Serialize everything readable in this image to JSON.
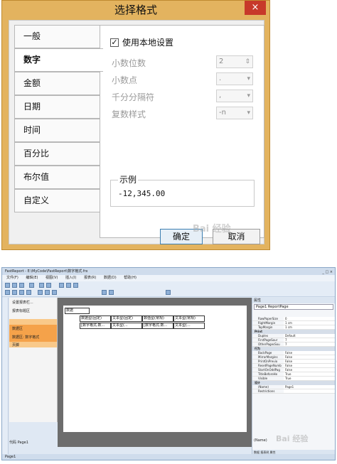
{
  "dialog": {
    "title": "选择格式",
    "close_glyph": "×",
    "tabs": [
      {
        "label": "一般",
        "active": false
      },
      {
        "label": "数字",
        "active": true
      },
      {
        "label": "金额",
        "active": false
      },
      {
        "label": "日期",
        "active": false
      },
      {
        "label": "时间",
        "active": false
      },
      {
        "label": "百分比",
        "active": false
      },
      {
        "label": "布尔值",
        "active": false
      },
      {
        "label": "自定义",
        "active": false
      }
    ],
    "use_local": {
      "label": "使用本地设置",
      "checked": true,
      "check_glyph": "✓"
    },
    "options": [
      {
        "label": "小数位数",
        "value": "2"
      },
      {
        "label": "小数点",
        "value": "."
      },
      {
        "label": "千分分隔符",
        "value": ","
      },
      {
        "label": "复数样式",
        "value": "-n"
      }
    ],
    "example": {
      "legend": "示例",
      "value": "-12,345.00"
    },
    "ok_label": "确定",
    "cancel_label": "取消",
    "watermark": "Bai 经验"
  },
  "designer": {
    "title": "FastReport - E:\\MyCode\\FastReport\\数字格式.frx",
    "window_buttons": "_ □ ×",
    "menu": [
      "文件(F)",
      "编辑(E)",
      "视图(V)",
      "插入(I)",
      "报表(R)",
      "数据(D)",
      "帮助(H)"
    ],
    "tree": {
      "header": "设置报表栏...",
      "title_band": "报表标题区",
      "data_band": "数据区",
      "data_band_sub": "数据区: 数字格式",
      "footer_band": "页脚"
    },
    "canvas": {
      "header_cell": "数据",
      "row1": [
        "数据型(固定)",
        "文本型(固定)",
        "数值型(常规)",
        "文本型(常规)"
      ],
      "row2": [
        "[数字格式.数...",
        "文本型(...",
        "[数字格式.数...",
        "文本型(..."
      ]
    },
    "page_tabs": "代码  Page1",
    "props": {
      "header": "属性",
      "combo": "Page1 ReportPage",
      "rows": [
        {
          "k": "RawPaperSize",
          "v": "0"
        },
        {
          "k": "RightMargin",
          "v": "1 cm"
        },
        {
          "k": "TopMargin",
          "v": "1 cm"
        }
      ],
      "cat_print": "Print",
      "rows_print": [
        {
          "k": "Duplex",
          "v": "Default"
        },
        {
          "k": "FirstPageSour",
          "v": "7"
        },
        {
          "k": "OtherPagesSou",
          "v": "7"
        }
      ],
      "cat_behavior": "行为",
      "rows_behavior": [
        {
          "k": "BackPage",
          "v": "False"
        },
        {
          "k": "MirrorMargins",
          "v": "False"
        },
        {
          "k": "PrintOnPrevio",
          "v": "False"
        },
        {
          "k": "ResetPageNumb",
          "v": "False"
        },
        {
          "k": "StartOnOddPag",
          "v": "False"
        },
        {
          "k": "TitleBeforeHe",
          "v": "True"
        },
        {
          "k": "Visible",
          "v": "True"
        }
      ],
      "cat_design": "设计",
      "rows_design": [
        {
          "k": "(Name)",
          "v": "Page1"
        },
        {
          "k": "Restrictions",
          "v": ""
        }
      ],
      "footer": "(Name)",
      "bottom_tabs": "数据  报表树  属性"
    },
    "status": "Page1",
    "watermark": "Bai 经验"
  }
}
